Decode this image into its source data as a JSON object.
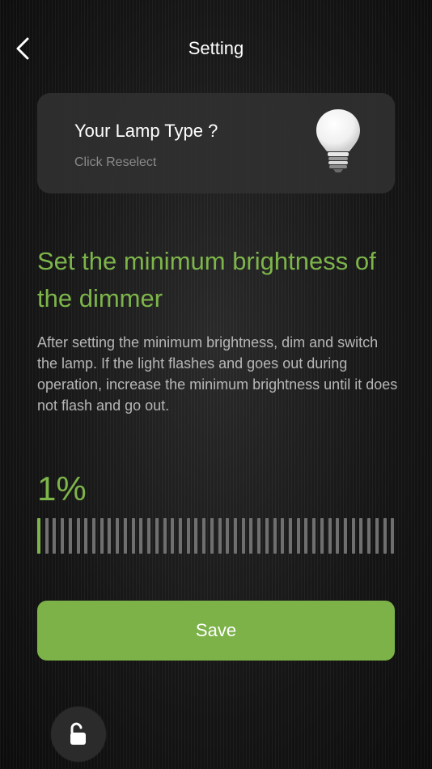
{
  "header": {
    "title": "Setting",
    "back_icon": "chevron-left-icon"
  },
  "lamp_card": {
    "title": "Your Lamp Type ?",
    "subtitle": "Click Reselect",
    "icon": "light-bulb-icon"
  },
  "dimmer": {
    "heading": "Set the minimum brightness of the dimmer",
    "description": "After setting the minimum brightness, dim and switch the lamp. If the light flashes and goes out during operation, increase the minimum brightness until it does not flash and go out.",
    "value_label": "1%",
    "value_percent": 1
  },
  "save_label": "Save",
  "lock_icon": "unlock-icon",
  "colors": {
    "accent": "#7db54a",
    "button": "#7cb248",
    "card": "#303030",
    "text_muted": "#b6b6b6"
  }
}
